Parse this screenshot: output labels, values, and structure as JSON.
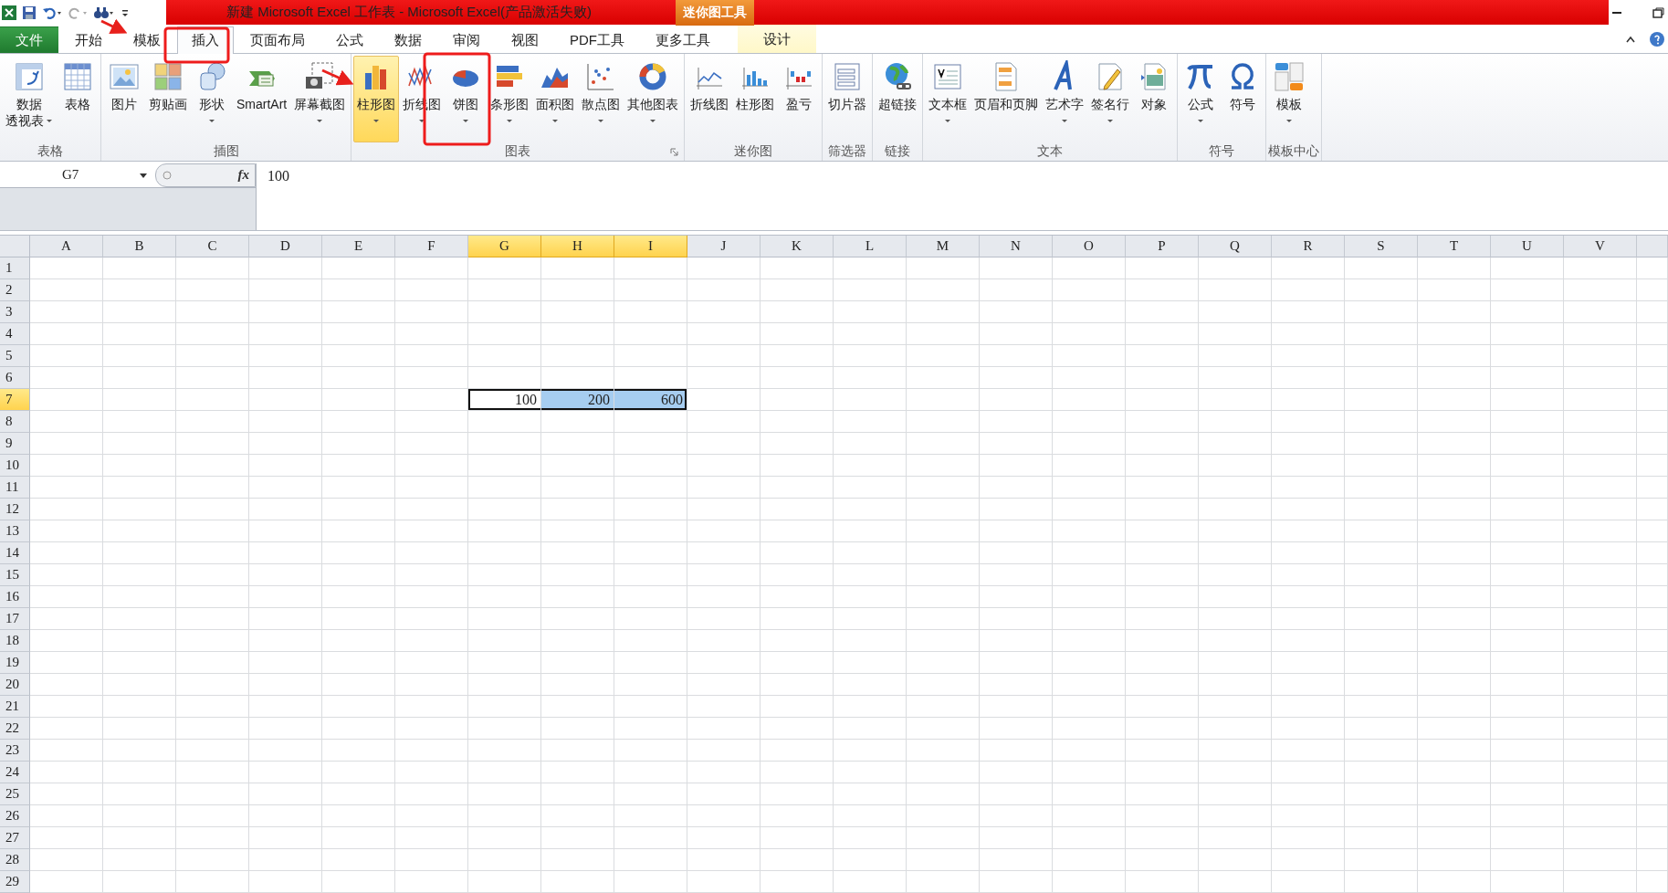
{
  "title_bar": {
    "title": "新建 Microsoft Excel 工作表 - Microsoft Excel(产品激活失败)",
    "context_tab": "迷你图工具"
  },
  "tabs": [
    {
      "label": "文件",
      "kind": "file",
      "selected": false
    },
    {
      "label": "开始",
      "kind": "normal",
      "selected": false
    },
    {
      "label": "模板",
      "kind": "normal",
      "selected": false
    },
    {
      "label": "插入",
      "kind": "normal",
      "selected": true
    },
    {
      "label": "页面布局",
      "kind": "normal",
      "selected": false
    },
    {
      "label": "公式",
      "kind": "normal",
      "selected": false
    },
    {
      "label": "数据",
      "kind": "normal",
      "selected": false
    },
    {
      "label": "审阅",
      "kind": "normal",
      "selected": false
    },
    {
      "label": "视图",
      "kind": "normal",
      "selected": false
    },
    {
      "label": "PDF工具",
      "kind": "normal",
      "selected": false
    },
    {
      "label": "更多工具",
      "kind": "normal",
      "selected": false
    },
    {
      "label": "设计",
      "kind": "context",
      "selected": false
    }
  ],
  "ribbon": {
    "groups": [
      {
        "label": "表格",
        "launcher": false,
        "buttons": [
          {
            "label": "数据",
            "label2": "透视表",
            "dropdown": true,
            "highlighted": false
          },
          {
            "label": "表格",
            "dropdown": false,
            "highlighted": false
          }
        ]
      },
      {
        "label": "插图",
        "launcher": false,
        "buttons": [
          {
            "label": "图片",
            "dropdown": false,
            "highlighted": false
          },
          {
            "label": "剪贴画",
            "dropdown": false,
            "highlighted": false
          },
          {
            "label": "形状",
            "dropdown": true,
            "highlighted": false
          },
          {
            "label": "SmartArt",
            "dropdown": false,
            "highlighted": false
          },
          {
            "label": "屏幕截图",
            "dropdown": true,
            "highlighted": false
          }
        ]
      },
      {
        "label": "图表",
        "launcher": true,
        "buttons": [
          {
            "label": "柱形图",
            "dropdown": true,
            "highlighted": true
          },
          {
            "label": "折线图",
            "dropdown": true,
            "highlighted": false
          },
          {
            "label": "饼图",
            "dropdown": true,
            "highlighted": false
          },
          {
            "label": "条形图",
            "dropdown": true,
            "highlighted": false
          },
          {
            "label": "面积图",
            "dropdown": true,
            "highlighted": false
          },
          {
            "label": "散点图",
            "dropdown": true,
            "highlighted": false
          },
          {
            "label": "其他图表",
            "dropdown": true,
            "highlighted": false
          }
        ]
      },
      {
        "label": "迷你图",
        "launcher": false,
        "buttons": [
          {
            "label": "折线图",
            "dropdown": false,
            "highlighted": false
          },
          {
            "label": "柱形图",
            "dropdown": false,
            "highlighted": false
          },
          {
            "label": "盈亏",
            "dropdown": false,
            "highlighted": false
          }
        ]
      },
      {
        "label": "筛选器",
        "launcher": false,
        "buttons": [
          {
            "label": "切片器",
            "dropdown": false,
            "highlighted": false
          }
        ]
      },
      {
        "label": "链接",
        "launcher": false,
        "buttons": [
          {
            "label": "超链接",
            "dropdown": false,
            "highlighted": false
          }
        ]
      },
      {
        "label": "文本",
        "launcher": false,
        "buttons": [
          {
            "label": "文本框",
            "dropdown": true,
            "highlighted": false
          },
          {
            "label": "页眉和页脚",
            "dropdown": false,
            "highlighted": false
          },
          {
            "label": "艺术字",
            "dropdown": true,
            "highlighted": false
          },
          {
            "label": "签名行",
            "dropdown": true,
            "highlighted": false
          },
          {
            "label": "对象",
            "dropdown": false,
            "highlighted": false
          }
        ]
      },
      {
        "label": "符号",
        "launcher": false,
        "buttons": [
          {
            "label": "公式",
            "dropdown": true,
            "highlighted": false
          },
          {
            "label": "符号",
            "dropdown": false,
            "highlighted": false
          }
        ]
      },
      {
        "label": "模板中心",
        "launcher": false,
        "buttons": [
          {
            "label": "模板",
            "dropdown": true,
            "highlighted": false
          }
        ]
      }
    ]
  },
  "formula_bar": {
    "name_box": "G7",
    "function_button": "fx",
    "formula": "100"
  },
  "sheet": {
    "columns": [
      {
        "label": "A",
        "selected": false
      },
      {
        "label": "B",
        "selected": false
      },
      {
        "label": "C",
        "selected": false
      },
      {
        "label": "D",
        "selected": false
      },
      {
        "label": "E",
        "selected": false
      },
      {
        "label": "F",
        "selected": false
      },
      {
        "label": "G",
        "selected": true
      },
      {
        "label": "H",
        "selected": true
      },
      {
        "label": "I",
        "selected": true
      },
      {
        "label": "J",
        "selected": false
      },
      {
        "label": "K",
        "selected": false
      },
      {
        "label": "L",
        "selected": false
      },
      {
        "label": "M",
        "selected": false
      },
      {
        "label": "N",
        "selected": false
      },
      {
        "label": "O",
        "selected": false
      },
      {
        "label": "P",
        "selected": false
      },
      {
        "label": "Q",
        "selected": false
      },
      {
        "label": "R",
        "selected": false
      },
      {
        "label": "S",
        "selected": false
      },
      {
        "label": "T",
        "selected": false
      },
      {
        "label": "U",
        "selected": false
      },
      {
        "label": "V",
        "selected": false
      }
    ],
    "rows": [
      {
        "label": "1",
        "selected": false
      },
      {
        "label": "2",
        "selected": false
      },
      {
        "label": "3",
        "selected": false
      },
      {
        "label": "4",
        "selected": false
      },
      {
        "label": "5",
        "selected": false
      },
      {
        "label": "6",
        "selected": false
      },
      {
        "label": "7",
        "selected": true,
        "cells": [
          null,
          null,
          null,
          null,
          null,
          null,
          {
            "value": "100",
            "selected": true,
            "active": true
          },
          {
            "value": "200",
            "selected": true,
            "active": false
          },
          {
            "value": "600",
            "selected": true,
            "active": false
          }
        ]
      },
      {
        "label": "8",
        "selected": false
      },
      {
        "label": "9",
        "selected": false
      },
      {
        "label": "10",
        "selected": false
      },
      {
        "label": "11",
        "selected": false
      },
      {
        "label": "12",
        "selected": false
      },
      {
        "label": "13",
        "selected": false
      },
      {
        "label": "14",
        "selected": false
      },
      {
        "label": "15",
        "selected": false
      },
      {
        "label": "16",
        "selected": false
      },
      {
        "label": "17",
        "selected": false
      },
      {
        "label": "18",
        "selected": false
      },
      {
        "label": "19",
        "selected": false
      },
      {
        "label": "20",
        "selected": false
      },
      {
        "label": "21",
        "selected": false
      },
      {
        "label": "22",
        "selected": false
      },
      {
        "label": "23",
        "selected": false
      },
      {
        "label": "24",
        "selected": false
      },
      {
        "label": "25",
        "selected": false
      },
      {
        "label": "26",
        "selected": false
      },
      {
        "label": "27",
        "selected": false
      },
      {
        "label": "28",
        "selected": false
      },
      {
        "label": "29",
        "selected": false
      }
    ]
  }
}
